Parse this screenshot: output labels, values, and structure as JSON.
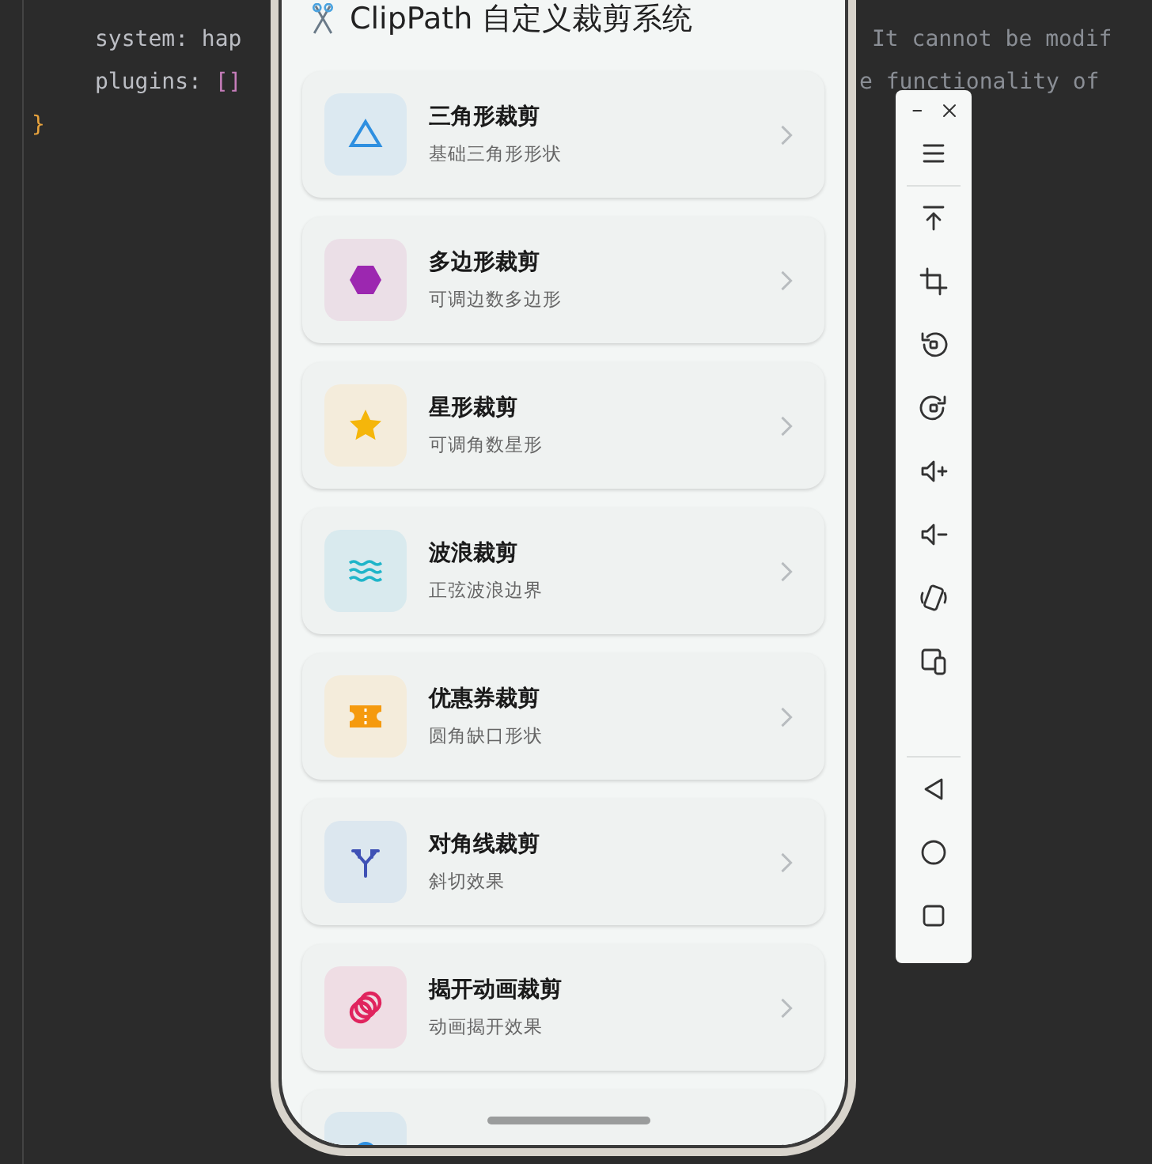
{
  "editor": {
    "lines": [
      {
        "left": [
          {
            "t": "system: hap",
            "kind": "key"
          }
        ],
        "right": "It cannot be modif"
      },
      {
        "left": [
          {
            "t": "plugins: ",
            "kind": "key"
          },
          {
            "t": "[]",
            "kind": "bracket"
          }
        ],
        "right": "e functionality of"
      },
      {
        "left": [
          {
            "t": "}",
            "kind": "brace"
          }
        ]
      }
    ]
  },
  "app": {
    "title": "ClipPath 自定义裁剪系统",
    "cards": [
      {
        "title": "三角形裁剪",
        "subtitle": "基础三角形形状",
        "kind": "triangle",
        "color": "#2e8fe0"
      },
      {
        "title": "多边形裁剪",
        "subtitle": "可调边数多边形",
        "kind": "hexagon",
        "color": "#9c27b0"
      },
      {
        "title": "星形裁剪",
        "subtitle": "可调角数星形",
        "kind": "star",
        "color": "#f5b60a"
      },
      {
        "title": "波浪裁剪",
        "subtitle": "正弦波浪边界",
        "kind": "waves",
        "color": "#1fb5c9"
      },
      {
        "title": "优惠券裁剪",
        "subtitle": "圆角缺口形状",
        "kind": "ticket",
        "color": "#f59a0e"
      },
      {
        "title": "对角线裁剪",
        "subtitle": "斜切效果",
        "kind": "split",
        "color": "#3f51b5"
      },
      {
        "title": "揭开动画裁剪",
        "subtitle": "动画揭开效果",
        "kind": "rings",
        "color": "#e0245e"
      },
      {
        "kind": "circle",
        "color": "#2e8fe0"
      }
    ]
  },
  "toolbar": {
    "top": [
      {
        "kind": "minimize"
      },
      {
        "kind": "close"
      }
    ],
    "groups": [
      [
        {
          "kind": "menu"
        }
      ],
      [
        {
          "kind": "pin-top"
        },
        {
          "kind": "crop"
        },
        {
          "kind": "rotate-left"
        },
        {
          "kind": "rotate-right"
        },
        {
          "kind": "volume-up"
        },
        {
          "kind": "volume-down"
        },
        {
          "kind": "rotate-device"
        },
        {
          "kind": "multi-device"
        }
      ],
      [
        {
          "kind": "back"
        },
        {
          "kind": "home"
        },
        {
          "kind": "recents"
        }
      ]
    ]
  }
}
